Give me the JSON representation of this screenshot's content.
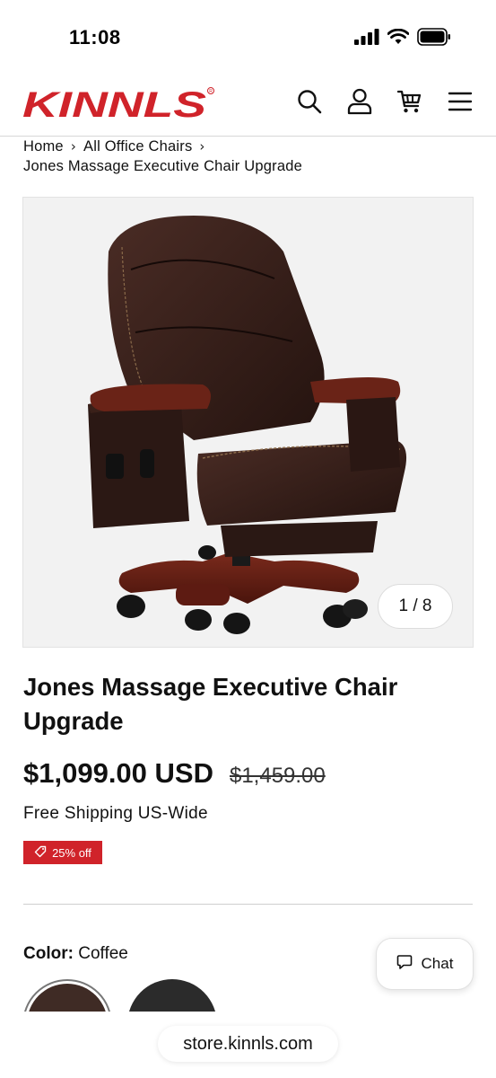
{
  "status_bar": {
    "time": "11:08",
    "icons": [
      "signal-icon",
      "wifi-icon",
      "battery-icon"
    ]
  },
  "header": {
    "logo_text": "KINNLS",
    "brand_color": "#d0232a",
    "icons": [
      "search-icon",
      "account-icon",
      "cart-icon",
      "menu-icon"
    ]
  },
  "breadcrumb": {
    "items": [
      "Home",
      "All Office Chairs",
      "Jones Massage Executive Chair Upgrade"
    ]
  },
  "gallery": {
    "counter": "1 / 8",
    "image_alt": "chair-image"
  },
  "product": {
    "title": "Jones Massage Executive Chair Upgrade",
    "price": "$1,099.00 USD",
    "compare_price": "$1,459.00",
    "shipping": "Free Shipping US-Wide",
    "badge": "25% off",
    "badge_color": "#d0232a"
  },
  "options": {
    "color_label": "Color:",
    "color_value": "Coffee",
    "swatches": [
      "#3f2b25",
      "#2b2b2b"
    ]
  },
  "chat": {
    "label": "Chat"
  },
  "browser": {
    "url": "store.kinnls.com"
  }
}
